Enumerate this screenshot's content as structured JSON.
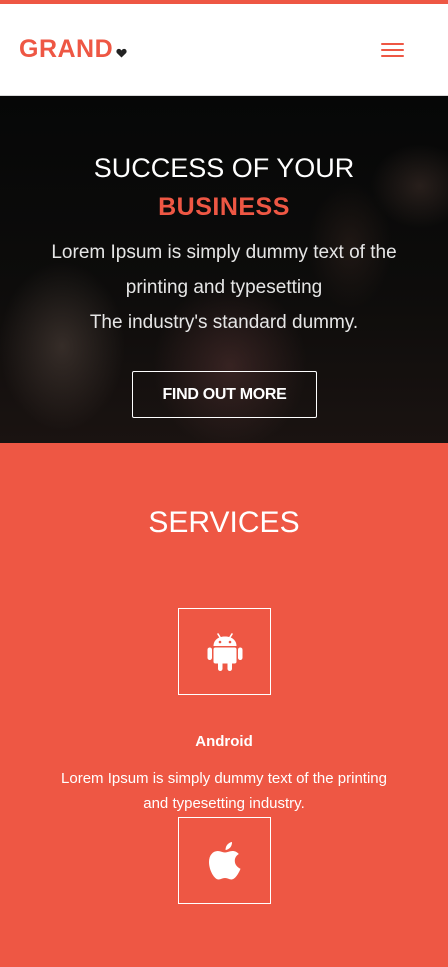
{
  "header": {
    "brand": "GRAND",
    "brand_icon": "heart-icon",
    "menu_icon": "hamburger-menu-icon"
  },
  "hero": {
    "title": "SUCCESS OF YOUR",
    "highlight": "BUSINESS",
    "text_line1": "Lorem Ipsum is simply dummy text of the",
    "text_line2": "printing and typesetting",
    "text_line3": "The industry's standard dummy.",
    "button_label": "FIND OUT MORE"
  },
  "services": {
    "title": "SERVICES",
    "items": [
      {
        "icon": "android-icon",
        "name": "Android",
        "desc_line1": "Lorem Ipsum is simply dummy text of the printing",
        "desc_line2": "and typesetting industry."
      },
      {
        "icon": "apple-icon"
      }
    ]
  },
  "colors": {
    "accent": "#ee5744",
    "hero_background": "#0b0b0b",
    "text_light": "#ffffff"
  }
}
